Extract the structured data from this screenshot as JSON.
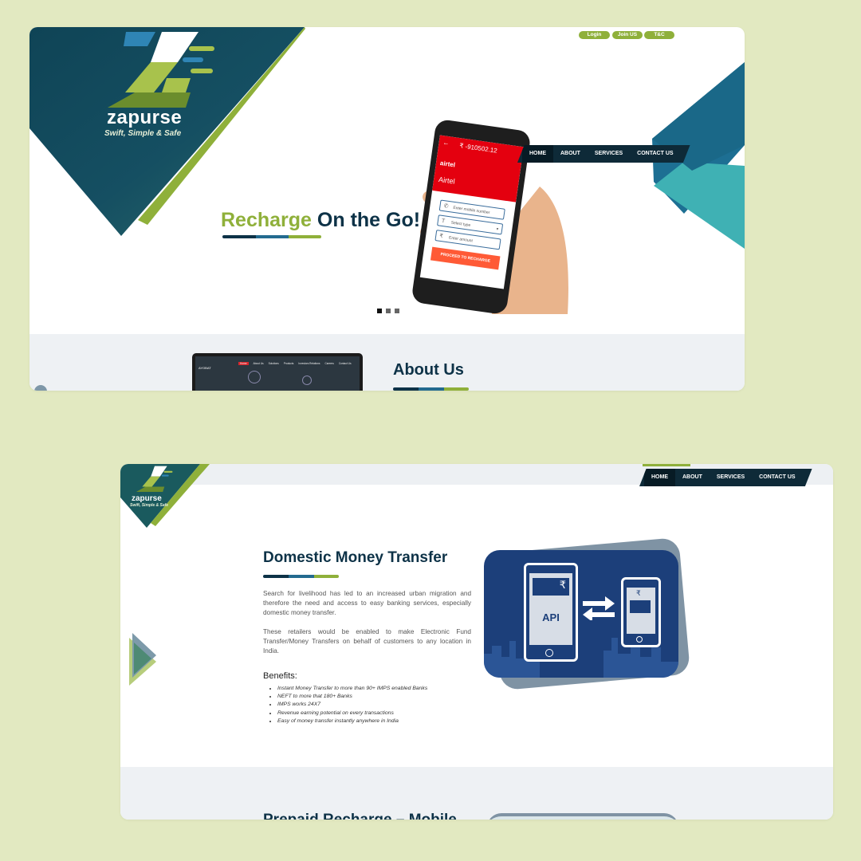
{
  "brand": {
    "name": "zapurse",
    "tagline": "Swift, Simple & Safe"
  },
  "top_links": [
    "Login",
    "Join US",
    "T&C"
  ],
  "nav": {
    "items": [
      "HOME",
      "ABOUT",
      "SERVICES",
      "CONTACT US"
    ]
  },
  "hero": {
    "headline_part1": "Recharge",
    "headline_part2": "On the Go!",
    "phone": {
      "amount": "₹ -910502.12",
      "operator_logo": "airtel",
      "operator": "Airtel",
      "mobile_placeholder": "Enter mobile number",
      "type_placeholder": "Select type",
      "amount_placeholder": "Enter amount",
      "cta": "PROCEED TO RECHARGE"
    },
    "carousel": {
      "count": 3,
      "active": 0
    }
  },
  "about": {
    "title": "About Us",
    "laptop_brand": "AYOBAT",
    "laptop_nav": [
      "Home",
      "About Us",
      "Solutions",
      "Products",
      "Investors Relations",
      "Careers",
      "Contact Us"
    ]
  },
  "dmt": {
    "title": "Domestic Money Transfer",
    "para1": "Search for livelihood has led to an increased urban migration and therefore the need and access to easy banking services, especially domestic money transfer.",
    "para2": "These retailers would be enabled to make Electronic Fund Transfer/Money Transfers on behalf of customers to any location in India.",
    "benefits_title": "Benefits:",
    "benefits": [
      "Instant Money Transfer to more than 90+ IMPS enabled Banks",
      "NEFT to more that 180+ Banks",
      "IMPS works 24X7",
      "Revenue earning potential on every transactions",
      "Easy of money transfer instantly anywhere in India"
    ],
    "illustration": {
      "api_label": "API",
      "rupee": "₹"
    }
  },
  "next_section": {
    "title": "Prepaid Recharge – Mobile"
  },
  "colors": {
    "navy": "#0d3247",
    "green": "#8fb03a",
    "blue": "#236a8f",
    "teal": "#3fb1b4",
    "airtel_red": "#e4000f",
    "cta_orange": "#ff5a36",
    "background": "#e2e9c1"
  }
}
